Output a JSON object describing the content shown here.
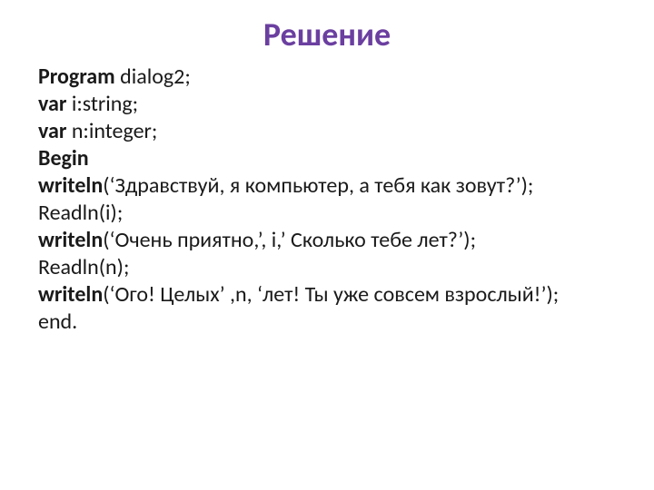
{
  "title": "Решение",
  "l1b": "Program",
  "l1n": " dialog2;",
  "l2b": "var",
  "l2n": " i:string;",
  "l3b": "var",
  "l3n": " n:integer;",
  "l4b": "Begin",
  "l5b": "writeln",
  "l5n": "(‘Здравствуй, я компьютер, а тебя как зовут?’);",
  "l6": "Readln(i);",
  "l7b": "writeln",
  "l7n": "(‘Очень приятно,’, i,’ Сколько тебе лет?’);",
  "l8": "Readln(n);",
  "l9b": "writeln",
  "l9n": "(‘Ого! Целых’ ,n, ‘лет! Ты уже совсем взрослый!’);",
  "l10": "end."
}
